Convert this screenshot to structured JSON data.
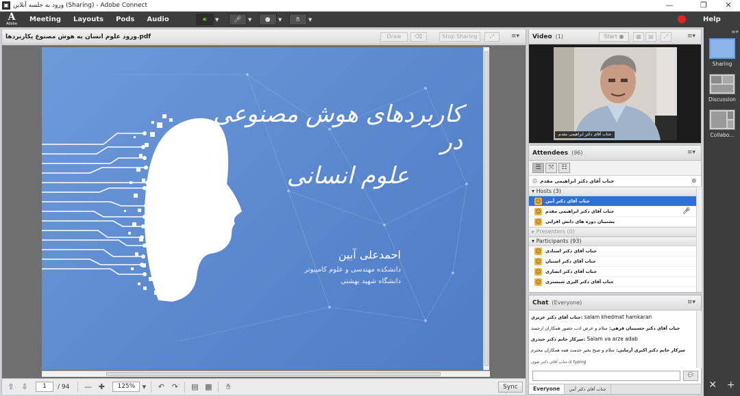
{
  "window": {
    "title": "ورود به جلسه آنلاین (Sharing) - Adobe Connect",
    "minimize": "—",
    "maximize": "❐",
    "close": "✕"
  },
  "menubar": {
    "logo_letter": "A",
    "logo_text": "Adobe",
    "items": [
      "Meeting",
      "Layouts",
      "Pods",
      "Audio"
    ],
    "help": "Help"
  },
  "share_pod": {
    "title": "ورود علوم انسان به هوش مصنوع یکاربردها.pdf",
    "draw": "Draw",
    "stop_sharing": "Stop Sharing",
    "slide": {
      "title_line1": "کاربردهای هوش مصنوعی در",
      "title_line2": "علوم انسانی",
      "author": "احمدعلی آبین",
      "department": "دانشکده مهندسی و علوم کامپیوتر",
      "university": "دانشگاه شهید بهشتی"
    },
    "toolbar": {
      "page": "1",
      "total": "/ 94",
      "zoom": "125%",
      "sync": "Sync"
    }
  },
  "video_pod": {
    "title": "Video",
    "count": "(1)",
    "start": "Start",
    "caption": "جناب آقای دکتر ابراهیمی مقدم"
  },
  "attendees_pod": {
    "title": "Attendees",
    "count": "(96)",
    "me": "جناب آقای دکتر ابراهیمی مقدم",
    "hosts_label": "Hosts (3)",
    "hosts": [
      "جناب آقای دکتر آبین",
      "جناب آقای دکتر ابراهیمی مقدم",
      "پشتیبان دوره های دانش افزایی"
    ],
    "presenters_label": "Presenters (0)",
    "participants_label": "Participants (93)",
    "participants": [
      "جناب آقای دکتر استادی",
      "جناب آقای دکتر استیان",
      "جناب آقای دکتر انصاری",
      "جناب آقای دکتر الیری شبستری"
    ]
  },
  "chat_pod": {
    "title": "Chat",
    "scope": "(Everyone)",
    "messages": [
      {
        "who": "جناب آقای دکتر عزیزی:",
        "text": "salam khedmat hamkaran"
      },
      {
        "who": "جناب آقای دکتر حسینیان قرهی:",
        "text": "سلام و عرض ادب حضور همکاران ارجمند"
      },
      {
        "who": "سرکار خانم دکتر حیدری:",
        "text": "Salam va arze adab"
      },
      {
        "who": "سرکار خانم دکتر اکبری آزمایی:",
        "text": "سلام و صبح بخیر خدمت همه همکاران محترم"
      }
    ],
    "typing_name": "جناب آقای دکتر تقوی",
    "typing_text": "is typing",
    "tabs": [
      "Everyone",
      "جناب آقای دکتر آبین"
    ]
  },
  "layouts": [
    {
      "label": "Sharing",
      "selected": true
    },
    {
      "label": "Discussion",
      "selected": false
    },
    {
      "label": "Collabo...",
      "selected": false
    }
  ]
}
